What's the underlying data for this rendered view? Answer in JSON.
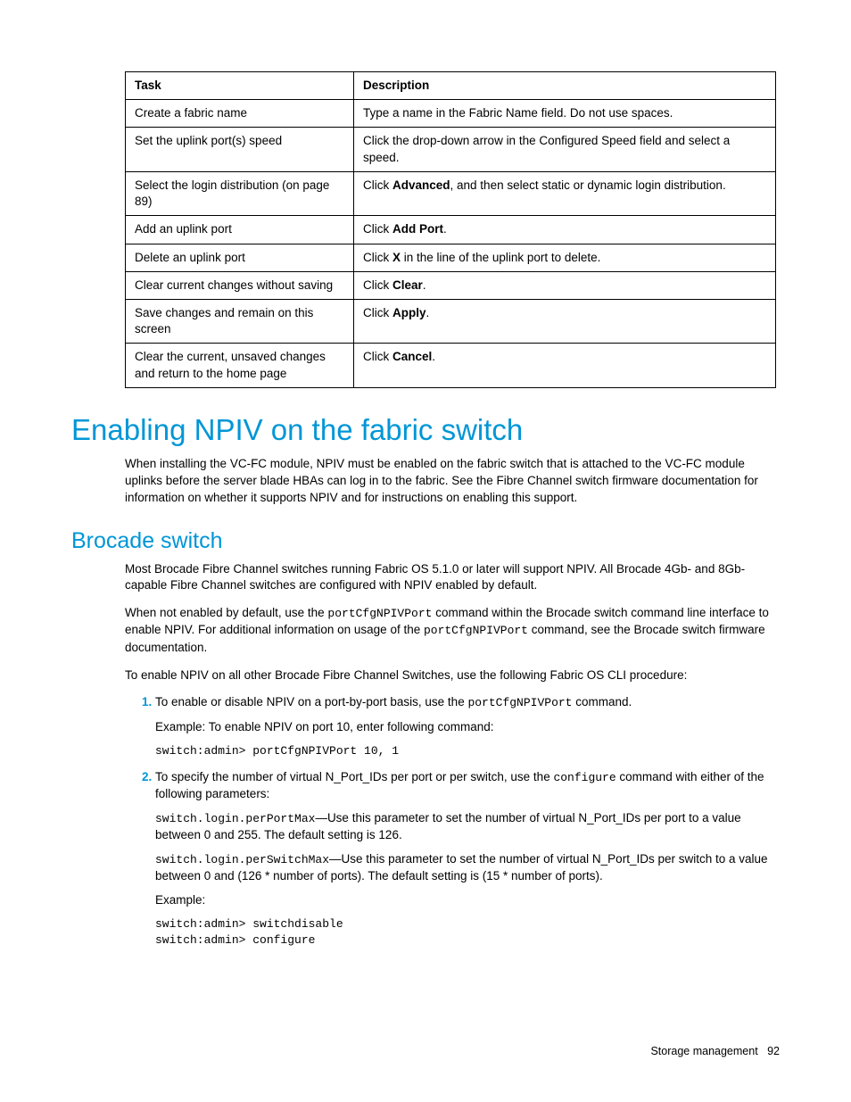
{
  "table": {
    "headers": {
      "task": "Task",
      "desc": "Description"
    },
    "rows": [
      {
        "task": "Create a fabric name",
        "desc": "Type a name in the Fabric Name field. Do not use spaces."
      },
      {
        "task": "Set the uplink port(s) speed",
        "desc": "Click the drop-down arrow in the Configured Speed field and select a speed."
      },
      {
        "task": "Select the login distribution (on page 89)",
        "desc_pre": "Click ",
        "desc_bold": "Advanced",
        "desc_post": ", and then select static or dynamic login distribution."
      },
      {
        "task": "Add an uplink port",
        "desc_pre": "Click ",
        "desc_bold": "Add Port",
        "desc_post": "."
      },
      {
        "task": "Delete an uplink port",
        "desc_pre": "Click ",
        "desc_bold": "X",
        "desc_post": " in the line of the uplink port to delete."
      },
      {
        "task": "Clear current changes without saving",
        "desc_pre": "Click ",
        "desc_bold": "Clear",
        "desc_post": "."
      },
      {
        "task": "Save changes and remain on this screen",
        "desc_pre": "Click ",
        "desc_bold": "Apply",
        "desc_post": "."
      },
      {
        "task": "Clear the current, unsaved changes and return to the home page",
        "desc_pre": "Click ",
        "desc_bold": "Cancel",
        "desc_post": "."
      }
    ]
  },
  "h1": "Enabling NPIV on the fabric switch",
  "p1": "When installing the VC-FC module, NPIV must be enabled on the fabric switch that is attached to the VC-FC module uplinks before the server blade HBAs can log in to the fabric. See the Fibre Channel switch firmware documentation for information on whether it supports NPIV and for instructions on enabling this support.",
  "h2": "Brocade switch",
  "p2": "Most Brocade Fibre Channel switches running Fabric OS 5.1.0 or later will support NPIV. All Brocade 4Gb- and 8Gb-capable Fibre Channel switches are configured with NPIV enabled by default.",
  "p3_a": "When not enabled by default, use the ",
  "p3_code1": "portCfgNPIVPort",
  "p3_b": " command within the Brocade switch command line interface to enable NPIV. For additional information on usage of the ",
  "p3_code2": "portCfgNPIVPort",
  "p3_c": " command, see the Brocade switch firmware documentation.",
  "p4": "To enable NPIV on all other Brocade Fibre Channel Switches, use the following Fabric OS CLI procedure:",
  "li1_a": "To enable or disable NPIV on a port-by-port basis, use the ",
  "li1_code": "portCfgNPIVPort",
  "li1_b": " command.",
  "li1_sub": "Example: To enable NPIV on port 10, enter following command:",
  "li1_cmd": "switch:admin> portCfgNPIVPort 10, 1",
  "li2_a": "To specify the number of virtual N_Port_IDs per port or per switch, use the ",
  "li2_code": "configure",
  "li2_b": " command with either of the following parameters:",
  "li2_p1_code": "switch.login.perPortMax",
  "li2_p1_text": "—Use this parameter to set the number of virtual N_Port_IDs per port to a value between 0 and 255. The default setting is 126.",
  "li2_p2_code": "switch.login.perSwitchMax",
  "li2_p2_text": "—Use this parameter to set the number of virtual N_Port_IDs per switch to a value between 0 and (126 * number of ports). The default setting is (15 * number of ports).",
  "li2_ex_label": "Example:",
  "li2_ex_code": "switch:admin> switchdisable\nswitch:admin> configure",
  "footer_section": "Storage management",
  "footer_page": "92"
}
